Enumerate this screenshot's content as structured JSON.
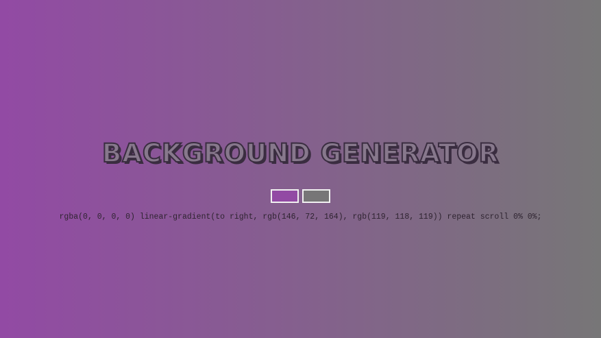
{
  "header": {
    "title": "BACKGROUND GENERATOR"
  },
  "pickers": {
    "color1": "#924aa4",
    "color2": "#777677"
  },
  "output": {
    "css_text": "rgba(0, 0, 0, 0) linear-gradient(to right, rgb(146, 72, 164), rgb(119, 118, 119)) repeat scroll 0% 0%;"
  }
}
